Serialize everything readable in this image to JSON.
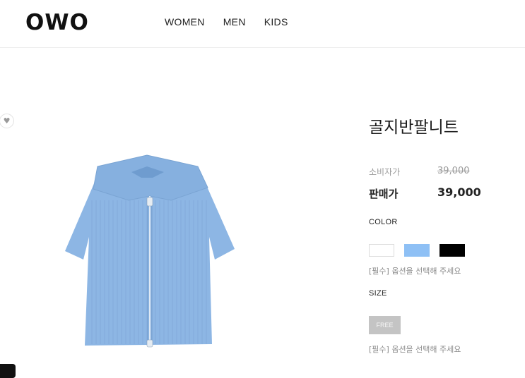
{
  "header": {
    "logo": "OWO",
    "nav": [
      "WOMEN",
      "MEN",
      "KIDS"
    ]
  },
  "product": {
    "name": "골지반팔니트",
    "consumer_price_label": "소비자가",
    "consumer_price": "39,000",
    "sale_price_label": "판매가",
    "sale_price": "39,000",
    "image_color": "#8db6e4"
  },
  "options": {
    "color_title": "COLOR",
    "colors": [
      {
        "name": "white",
        "hex": "#ffffff"
      },
      {
        "name": "sky blue",
        "hex": "#8ec0f5"
      },
      {
        "name": "black",
        "hex": "#000000"
      }
    ],
    "color_notice": "[필수] 옵션을 선택해 주세요",
    "size_title": "SIZE",
    "sizes": [
      "FREE"
    ],
    "size_notice": "[필수] 옵션을 선택해 주세요"
  },
  "icons": {
    "wishlist": "heart-icon"
  }
}
